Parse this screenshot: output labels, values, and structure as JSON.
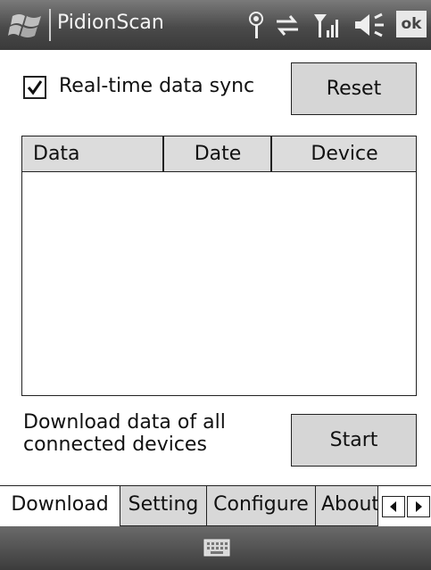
{
  "titlebar": {
    "app_title": "PidionScan",
    "ok_label": "ok",
    "icons": [
      "windows-start-icon",
      "antenna-icon",
      "sync-arrows-icon",
      "signal-strength-icon",
      "speaker-icon"
    ]
  },
  "sync": {
    "checkbox_checked": true,
    "label": "Real-time data sync"
  },
  "buttons": {
    "reset_label": "Reset",
    "start_label": "Start"
  },
  "list": {
    "columns": [
      "Data",
      "Date",
      "Device"
    ],
    "rows": []
  },
  "download": {
    "description": "Download data of all connected devices"
  },
  "tabs": [
    {
      "label": "Download",
      "active": true
    },
    {
      "label": "Setting",
      "active": false
    },
    {
      "label": "Configure",
      "active": false
    },
    {
      "label": "About",
      "active": false
    }
  ],
  "bottombar": {
    "icon": "keyboard-icon"
  }
}
